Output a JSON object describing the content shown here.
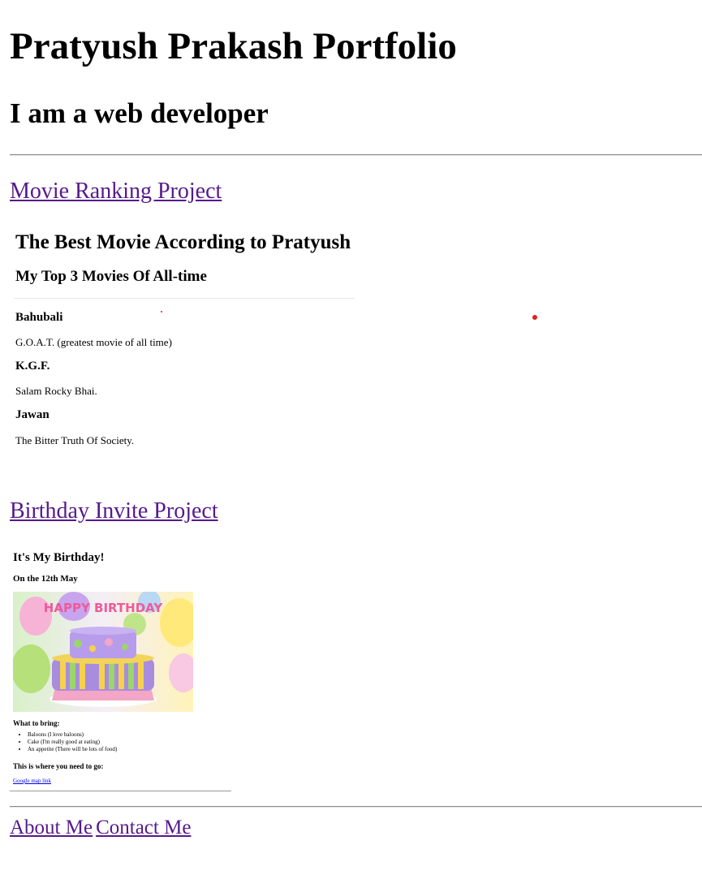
{
  "header": {
    "title": "Pratyush Prakash Portfolio",
    "subtitle": "I am a web developer"
  },
  "projects": [
    {
      "label": "Movie Ranking Project"
    },
    {
      "label": "Birthday Invite Project"
    }
  ],
  "movie_page": {
    "title": "The Best Movie According to Pratyush",
    "subtitle": "My Top 3 Movies Of All-time",
    "movies": [
      {
        "name": "Bahubali",
        "description": "G.O.A.T. (greatest movie of all time)"
      },
      {
        "name": "K.G.F.",
        "description": "Salam Rocky Bhai."
      },
      {
        "name": "Jawan",
        "description": "The Bitter Truth Of Society."
      }
    ]
  },
  "birthday_page": {
    "title": "It's My Birthday!",
    "date": "On the 12th May",
    "image_text": "HAPPY BIRTHDAY",
    "bring_heading": "What to bring:",
    "bring_items": [
      "Baloons (I love baloons)",
      "Cake (I'm really good at eating)",
      "An appetite (There will be lots of food)"
    ],
    "where_heading": "This is where you need to go:",
    "map_link": "Google map link"
  },
  "footer": {
    "about": "About Me",
    "contact": "Contact Me"
  },
  "colors": {
    "visited_link": "#551a8b",
    "link": "#0000ee",
    "dot": "#e0201f"
  }
}
